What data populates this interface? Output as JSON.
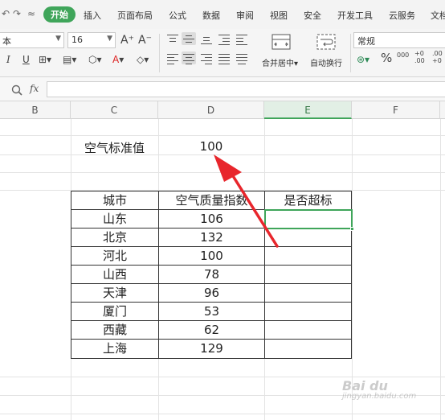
{
  "quick_access": {
    "undo_icon": "↶",
    "redo_icon": "↷",
    "more_icon": "≈"
  },
  "menu": {
    "tabs": [
      "开始",
      "插入",
      "页面布局",
      "公式",
      "数据",
      "审阅",
      "视图",
      "安全",
      "开发工具",
      "云服务",
      "文档"
    ],
    "active_tab": "开始"
  },
  "ribbon": {
    "font_name": "本",
    "font_size": "16",
    "grow_font": "A⁺",
    "shrink_font": "A⁻",
    "italic": "I",
    "underline": "U",
    "merge_center": "合并居中▾",
    "wrap_text": "自动换行",
    "number_format": "常规",
    "percent": "%",
    "thousands": "000",
    "inc_decimal": "+0 .00",
    "dec_decimal": ".00 +0"
  },
  "formula_bar": {
    "fx_label": "fx",
    "value": ""
  },
  "columns": [
    {
      "label": "B",
      "active": false
    },
    {
      "label": "C",
      "active": false
    },
    {
      "label": "D",
      "active": false
    },
    {
      "label": "E",
      "active": true
    },
    {
      "label": "F",
      "active": false
    }
  ],
  "standard": {
    "label": "空气标准值",
    "value": "100"
  },
  "table": {
    "headers": [
      "城市",
      "空气质量指数",
      "是否超标"
    ],
    "rows": [
      [
        "山东",
        "106",
        ""
      ],
      [
        "北京",
        "132",
        ""
      ],
      [
        "河北",
        "100",
        ""
      ],
      [
        "山西",
        "78",
        ""
      ],
      [
        "天津",
        "96",
        ""
      ],
      [
        "厦门",
        "53",
        ""
      ],
      [
        "西藏",
        "62",
        ""
      ],
      [
        "上海",
        "129",
        ""
      ]
    ]
  },
  "colors": {
    "accent_green": "#3fa55a",
    "arrow_red": "#e8262c"
  },
  "watermark": {
    "text": "Bai du",
    "sub": "jingyan.baidu.com"
  }
}
